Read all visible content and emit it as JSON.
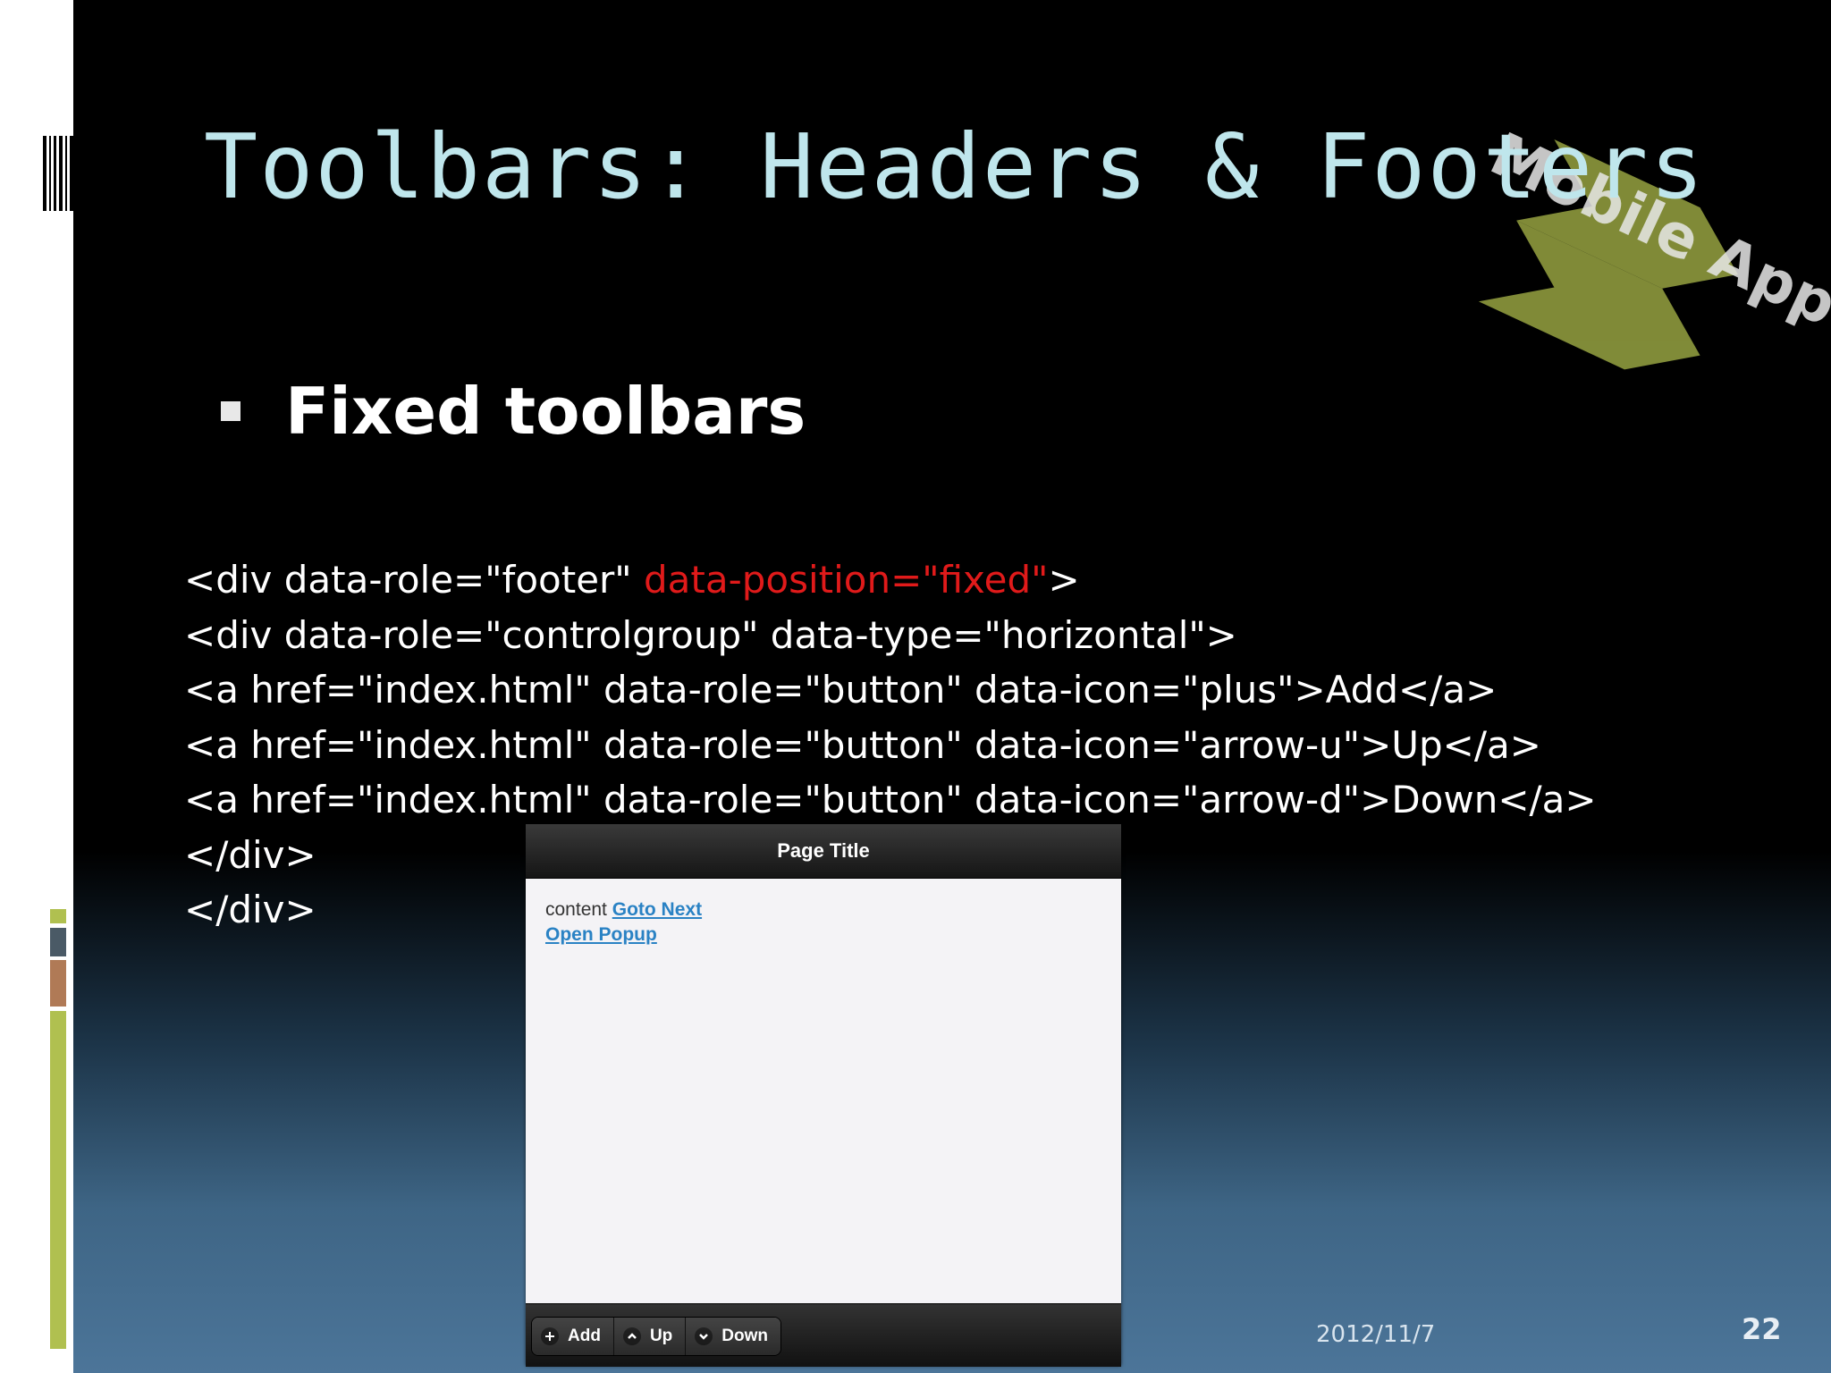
{
  "slide": {
    "title": "Toolbars: Headers & Footers",
    "bullet": "Fixed toolbars",
    "code_lines": [
      {
        "before": "<div data-role=\"footer\" ",
        "highlight": "data-position=\"fixed\"",
        "after": ">"
      },
      {
        "before": "<div data-role=\"controlgroup\" data-type=\"horizontal\">",
        "highlight": "",
        "after": ""
      },
      {
        "before": "<a href=\"index.html\" data-role=\"button\" data-icon=\"plus\">Add</a>",
        "highlight": "",
        "after": ""
      },
      {
        "before": "<a href=\"index.html\" data-role=\"button\" data-icon=\"arrow-u\">Up</a>",
        "highlight": "",
        "after": ""
      },
      {
        "before": "<a href=\"index.html\" data-role=\"button\" data-icon=\"arrow-d\">Down</a>",
        "highlight": "",
        "after": ""
      },
      {
        "before": "</div>",
        "highlight": "",
        "after": ""
      },
      {
        "before": "</div>",
        "highlight": "",
        "after": ""
      }
    ],
    "date": "2012/11/7",
    "page_number": "22"
  },
  "logo": {
    "text": "Mobile App",
    "icon": "chevron-stack-icon"
  },
  "phone": {
    "header_title": "Page Title",
    "content_text": "content",
    "link_goto_next": "Goto Next",
    "link_open_popup": "Open Popup",
    "footer_buttons": [
      {
        "label": "Add",
        "icon": "plus-icon"
      },
      {
        "label": "Up",
        "icon": "arrow-up-icon"
      },
      {
        "label": "Down",
        "icon": "arrow-down-icon"
      }
    ]
  },
  "colors": {
    "title": "#bfe6ec",
    "highlight": "#e01a1a",
    "accent_green": "#b0c050",
    "accent_slate": "#4a5a66",
    "accent_brown": "#b07a56",
    "link": "#2a82c4"
  }
}
